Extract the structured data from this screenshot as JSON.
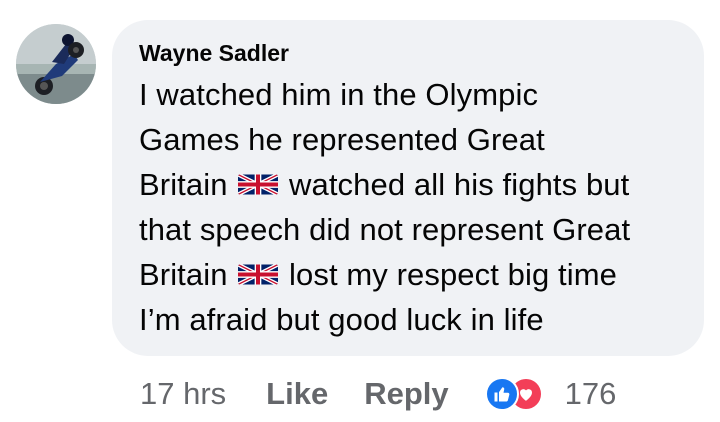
{
  "comment": {
    "author": "Wayne Sadler",
    "lines": [
      {
        "before": "I watched him in the Olympic",
        "flag": false,
        "after": ""
      },
      {
        "before": "Games he represented Great",
        "flag": false,
        "after": ""
      },
      {
        "before": "Britain ",
        "flag": true,
        "after": " watched all his fights but"
      },
      {
        "before": "that speech did not represent Great",
        "flag": false,
        "after": ""
      },
      {
        "before": "Britain ",
        "flag": true,
        "after": " lost my respect big time"
      },
      {
        "before": "I’m afraid but good luck in life",
        "flag": false,
        "after": ""
      }
    ],
    "flag_icon": "uk-flag-emoji"
  },
  "actions": {
    "time": "17 hrs",
    "like_label": "Like",
    "reply_label": "Reply",
    "reaction_count": "176",
    "reaction_icons": [
      "like-icon",
      "love-icon"
    ]
  },
  "colors": {
    "bubble_bg": "#f0f2f5",
    "meta_text": "#65676b",
    "like_blue": "#1877f2",
    "love_red": "#f33e58"
  }
}
